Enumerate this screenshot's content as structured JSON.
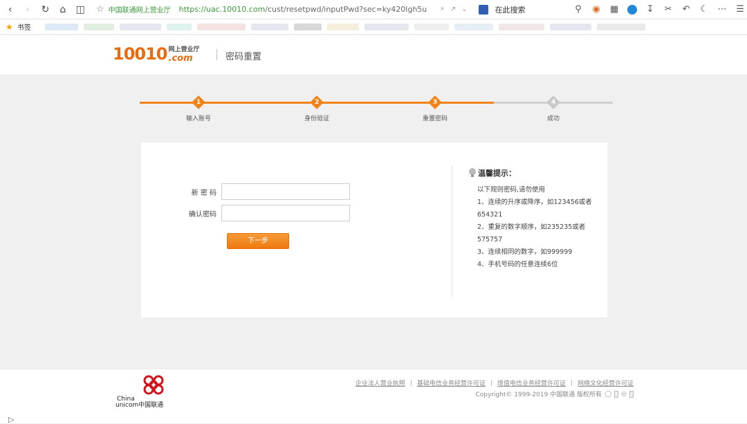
{
  "browser": {
    "site_name": "中国联通网上营业厅",
    "url_scheme_host": "https://uac.10010.com",
    "url_path": "/cust/resetpwd/inputPwd?sec=ky420lgh5u",
    "search_placeholder": "在此搜索",
    "bookmarks_label": "书签"
  },
  "header": {
    "logo_number": "10010",
    "logo_hall": "网上营业厅",
    "logo_com": ".com",
    "title": "密码重置"
  },
  "steps": [
    {
      "num": "1",
      "label": "输入账号",
      "state": "done"
    },
    {
      "num": "2",
      "label": "身份验证",
      "state": "done"
    },
    {
      "num": "3",
      "label": "重置密码",
      "state": "done"
    },
    {
      "num": "4",
      "label": "成功",
      "state": "todo"
    }
  ],
  "form": {
    "new_password_label": "新 密 码",
    "new_password_value": "",
    "confirm_password_label": "确认密码",
    "confirm_password_value": "",
    "next_button": "下一步"
  },
  "tips": {
    "title": "温馨提示：",
    "lines": [
      "以下规则密码,请勿使用",
      "1、连续的升序或降序，如123456或者",
      "654321",
      "2、重复的数字顺序，如235235或者",
      "575757",
      "3、连续相同的数字，如999999",
      "4、手机号码的任意连续6位"
    ]
  },
  "footer": {
    "brand_china": "China",
    "brand_unicom": "unicom中国联通",
    "links": [
      "企业法人营业执照",
      "基础电信业务经营许可证",
      "增值电信业务经营许可证",
      "网络文化经营许可证"
    ],
    "copyright": "Copyright© 1999-2019  中国联通 版权所有"
  },
  "colors": {
    "accent": "#f08319",
    "link_green": "#3a9a3a",
    "step_inactive": "#c8c8c8"
  }
}
